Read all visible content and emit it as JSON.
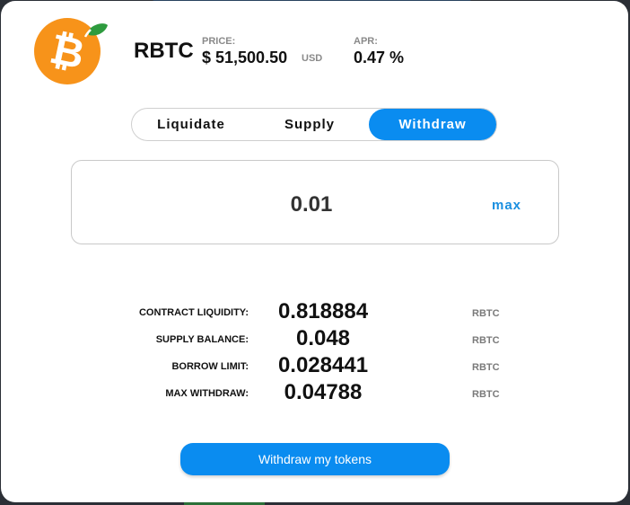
{
  "asset": {
    "icon": "bitcoin-orange-leaf-icon",
    "name": "RBTC",
    "price_label": "PRICE:",
    "price_value": "$ 51,500.50",
    "price_unit": "USD",
    "apr_label": "APR:",
    "apr_value": "0.47 %"
  },
  "tabs": [
    {
      "label": "Liquidate",
      "active": false
    },
    {
      "label": "Supply",
      "active": false
    },
    {
      "label": "Withdraw",
      "active": true
    }
  ],
  "amount": {
    "value": "0.01",
    "max_label": "max"
  },
  "details": [
    {
      "label": "CONTRACT LIQUIDITY:",
      "value": "0.818884",
      "unit": "RBTC"
    },
    {
      "label": "SUPPLY BALANCE:",
      "value": "0.048",
      "unit": "RBTC"
    },
    {
      "label": "BORROW LIMIT:",
      "value": "0.028441",
      "unit": "RBTC"
    },
    {
      "label": "MAX WITHDRAW:",
      "value": "0.04788",
      "unit": "RBTC"
    }
  ],
  "action": {
    "label": "Withdraw my tokens"
  },
  "colors": {
    "accent": "#0a8cf0",
    "bitcoin_orange": "#f7931a",
    "leaf_green": "#2e9b3e"
  }
}
